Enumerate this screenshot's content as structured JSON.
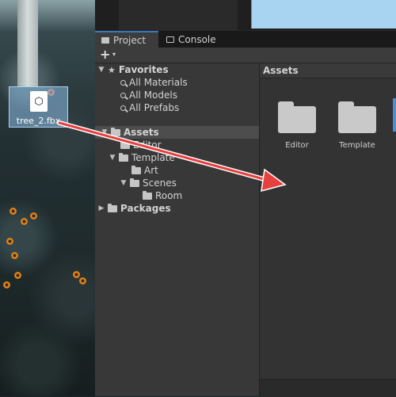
{
  "desktop": {
    "file_icon": "unity-package-icon",
    "file_name": "tree_2.fbx"
  },
  "editor": {
    "tabs": [
      {
        "label": "Project",
        "icon": "folder-icon",
        "active": true
      },
      {
        "label": "Console",
        "icon": "console-icon",
        "active": false
      }
    ],
    "toolbar": {
      "create_label": "+",
      "create_caret": "▾"
    },
    "tree": {
      "favorites": {
        "label": "Favorites",
        "items": [
          "All Materials",
          "All Models",
          "All Prefabs"
        ]
      },
      "assets": {
        "label": "Assets",
        "children": {
          "editor": "Editor",
          "template": "Template",
          "art": "Art",
          "scenes": "Scenes",
          "room": "Room"
        }
      },
      "packages": {
        "label": "Packages"
      }
    },
    "assets_panel": {
      "breadcrumb": "Assets",
      "items": [
        "Editor",
        "Template"
      ]
    }
  },
  "colors": {
    "arrow": "#e8403e",
    "selection": "#3a79bb",
    "panel": "#383838"
  }
}
